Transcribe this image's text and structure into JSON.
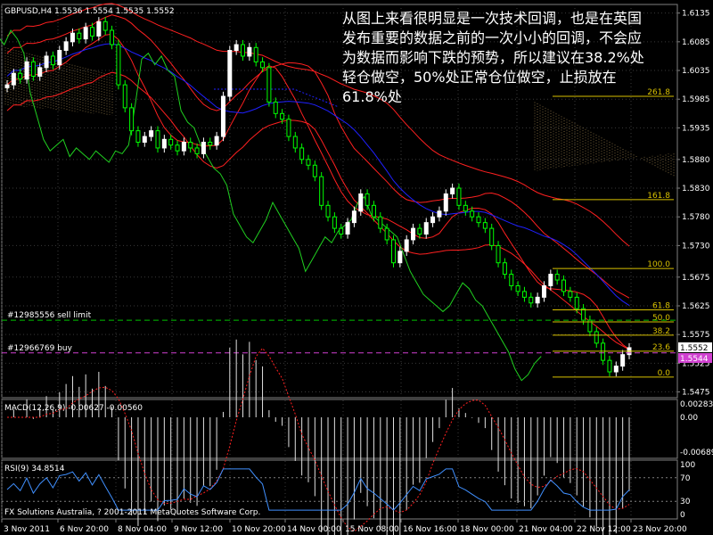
{
  "window": {
    "symbol_title": "GBPUSD,H4",
    "ohlc": "1.5536 1.5554 1.5535 1.5552",
    "copyright": "FX Solutions Australia, ? 2001-2011 MetaQuotes Software Corp."
  },
  "note_lines": [
    "从图上来看很明显是一次技术回调，也是在英国",
    "发布重要的数据之前的一次小小的回调，不会应",
    "为数据而影响下跌的预势，所以建议在38.2%处",
    "轻仓做空，50%处正常仓位做空，止损放在",
    "61.8%处"
  ],
  "orders": [
    {
      "label": "#12985556 sell limit",
      "price": 1.56,
      "color": "#00c000"
    },
    {
      "label": "#12966769 buy",
      "price": 1.5543,
      "color": "#d040d0"
    }
  ],
  "fib_levels": [
    {
      "label": "261.8",
      "price": 1.599
    },
    {
      "label": "161.8",
      "price": 1.581
    },
    {
      "label": "100.0",
      "price": 1.569
    },
    {
      "label": "61.8",
      "price": 1.5618
    },
    {
      "label": "50.0",
      "price": 1.5597
    },
    {
      "label": "38.2",
      "price": 1.5574
    },
    {
      "label": "23.6",
      "price": 1.5546
    },
    {
      "label": "0.0",
      "price": 1.5501
    }
  ],
  "price_axis": {
    "ticks": [
      "1.6135",
      "1.6085",
      "1.6035",
      "1.5985",
      "1.5935",
      "1.5880",
      "1.5830",
      "1.5780",
      "1.5730",
      "1.5675",
      "1.5625",
      "1.5575",
      "1.5525",
      "1.5475"
    ],
    "current": "1.5552",
    "bid_tag": "1.5544"
  },
  "time_axis": {
    "ticks": [
      "3 Nov 2011",
      "6 Nov 20:00",
      "8 Nov 04:00",
      "9 Nov 12:00",
      "10 Nov 20:00",
      "14 Nov 00:00",
      "15 Nov 08:00",
      "16 Nov 16:00",
      "18 Nov 00:00",
      "21 Nov 04:00",
      "22 Nov 12:00",
      "23 Nov 20:00"
    ]
  },
  "macd": {
    "label": "MACD(12,26,9) -0.00627 -0.00560",
    "ticks": [
      "0.00283",
      "0.00",
      "-0.00689"
    ]
  },
  "rsi": {
    "label": "RSI(9) 34.8514",
    "ticks": [
      "100",
      "70",
      "30",
      "0"
    ]
  },
  "colors": {
    "grid": "#3a3a3a",
    "bull": "#ffffff",
    "bear": "#00ff00",
    "bands": "#ff2020",
    "ma_blue": "#2020ff",
    "fib": "#d8c000",
    "cloud": "#c0a060",
    "green_line": "#20d020",
    "rsi_line": "#4090ff"
  },
  "chart_data": {
    "type": "candlestick",
    "title": "GBPUSD,H4",
    "ylim": [
      1.5465,
      1.615
    ],
    "closes": [
      1.601,
      1.603,
      1.602,
      1.605,
      1.6025,
      1.604,
      1.606,
      1.6045,
      1.607,
      1.6085,
      1.61,
      1.609,
      1.611,
      1.6095,
      1.612,
      1.6105,
      1.608,
      1.601,
      1.597,
      1.593,
      1.591,
      1.592,
      1.593,
      1.59,
      1.5915,
      1.5905,
      1.5895,
      1.591,
      1.59,
      1.589,
      1.591,
      1.5905,
      1.592,
      1.599,
      1.607,
      1.608,
      1.606,
      1.6075,
      1.605,
      1.604,
      1.598,
      1.596,
      1.595,
      1.592,
      1.59,
      1.588,
      1.587,
      1.585,
      1.58,
      1.578,
      1.576,
      1.575,
      1.577,
      1.579,
      1.582,
      1.58,
      1.578,
      1.576,
      1.574,
      1.57,
      1.572,
      1.574,
      1.576,
      1.575,
      1.577,
      1.578,
      1.579,
      1.582,
      1.583,
      1.58,
      1.579,
      1.578,
      1.577,
      1.576,
      1.573,
      1.57,
      1.568,
      1.566,
      1.565,
      1.564,
      1.563,
      1.564,
      1.566,
      1.568,
      1.567,
      1.565,
      1.564,
      1.562,
      1.56,
      1.558,
      1.556,
      1.553,
      1.551,
      1.552,
      1.554,
      1.5552
    ]
  }
}
